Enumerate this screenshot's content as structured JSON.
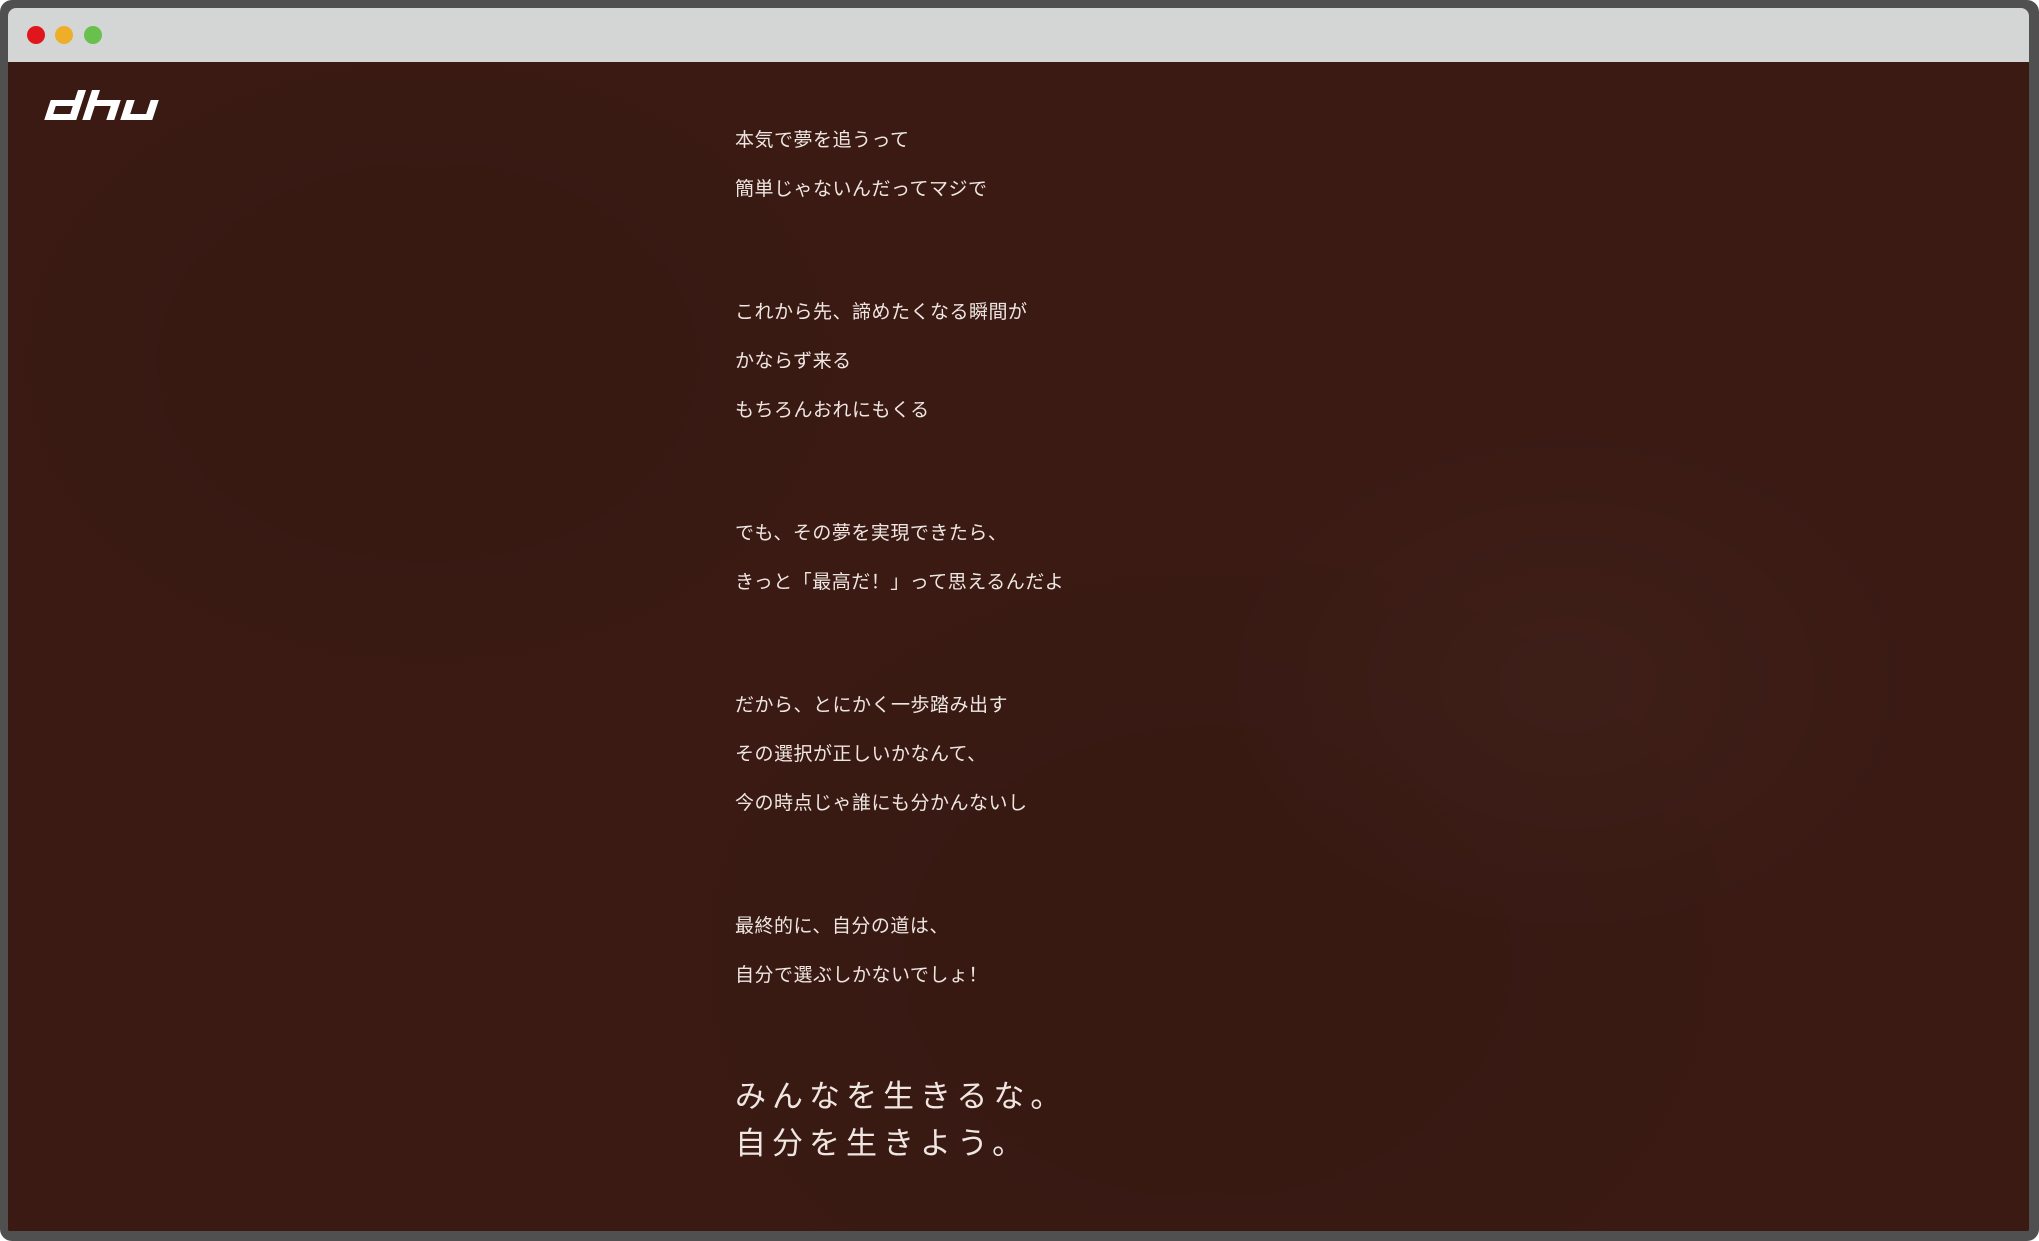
{
  "window": {
    "controls": [
      "close",
      "minimize",
      "maximize"
    ],
    "control_colors": {
      "close": "#e0161c",
      "minimize": "#eeae2a",
      "maximize": "#6ac04c"
    }
  },
  "brand": {
    "logo_text": "dhu",
    "logo_color": "#ffffff"
  },
  "theme": {
    "background": "#3a1a13",
    "text_color": "#efe6e2"
  },
  "poem": {
    "stanzas": [
      [
        "本気で夢を追うって",
        "簡単じゃないんだってマジで"
      ],
      [
        "これから先、諦めたくなる瞬間が",
        "かならず来る",
        "もちろんおれにもくる"
      ],
      [
        "でも、その夢を実現できたら、",
        "きっと「最高だ！」って思えるんだよ"
      ],
      [
        "だから、とにかく一歩踏み出す",
        "その選択が正しいかなんて、",
        "今の時点じゃ誰にも分かんないし"
      ],
      [
        "最終的に、自分の道は、",
        "自分で選ぶしかないでしょ！"
      ]
    ],
    "closing": [
      "みんなを生きるな。",
      "自分を生きよう。"
    ]
  }
}
